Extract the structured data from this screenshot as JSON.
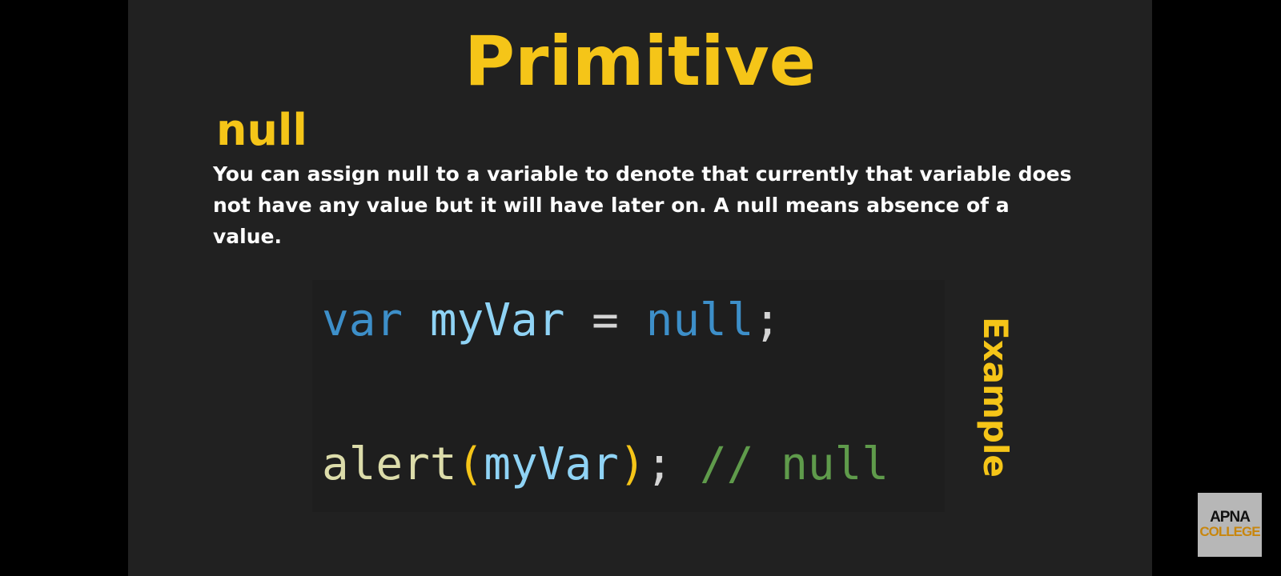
{
  "slide": {
    "title": "Primitive",
    "topic": "null",
    "description": "You can assign null to a variable to denote that currently that variable does not have any value but it will have later on. A null means absence of a value.",
    "side_label": "Example"
  },
  "code": {
    "line1": {
      "keyword": "var",
      "identifier": "myVar",
      "operator": "=",
      "value": "null",
      "terminator": ";"
    },
    "line2": {
      "function": "alert",
      "open_paren": "(",
      "argument": "myVar",
      "close_paren": ")",
      "terminator": ";",
      "comment": "// null"
    }
  },
  "logo": {
    "line1": "APNA",
    "line2": "COLLEGE"
  },
  "colors": {
    "accent": "#f5c518",
    "slide_background": "#212121",
    "keyword": "#3d8fc9",
    "identifier": "#8fd3f5",
    "function": "#dcdcaa",
    "comment": "#5f9b4b"
  }
}
